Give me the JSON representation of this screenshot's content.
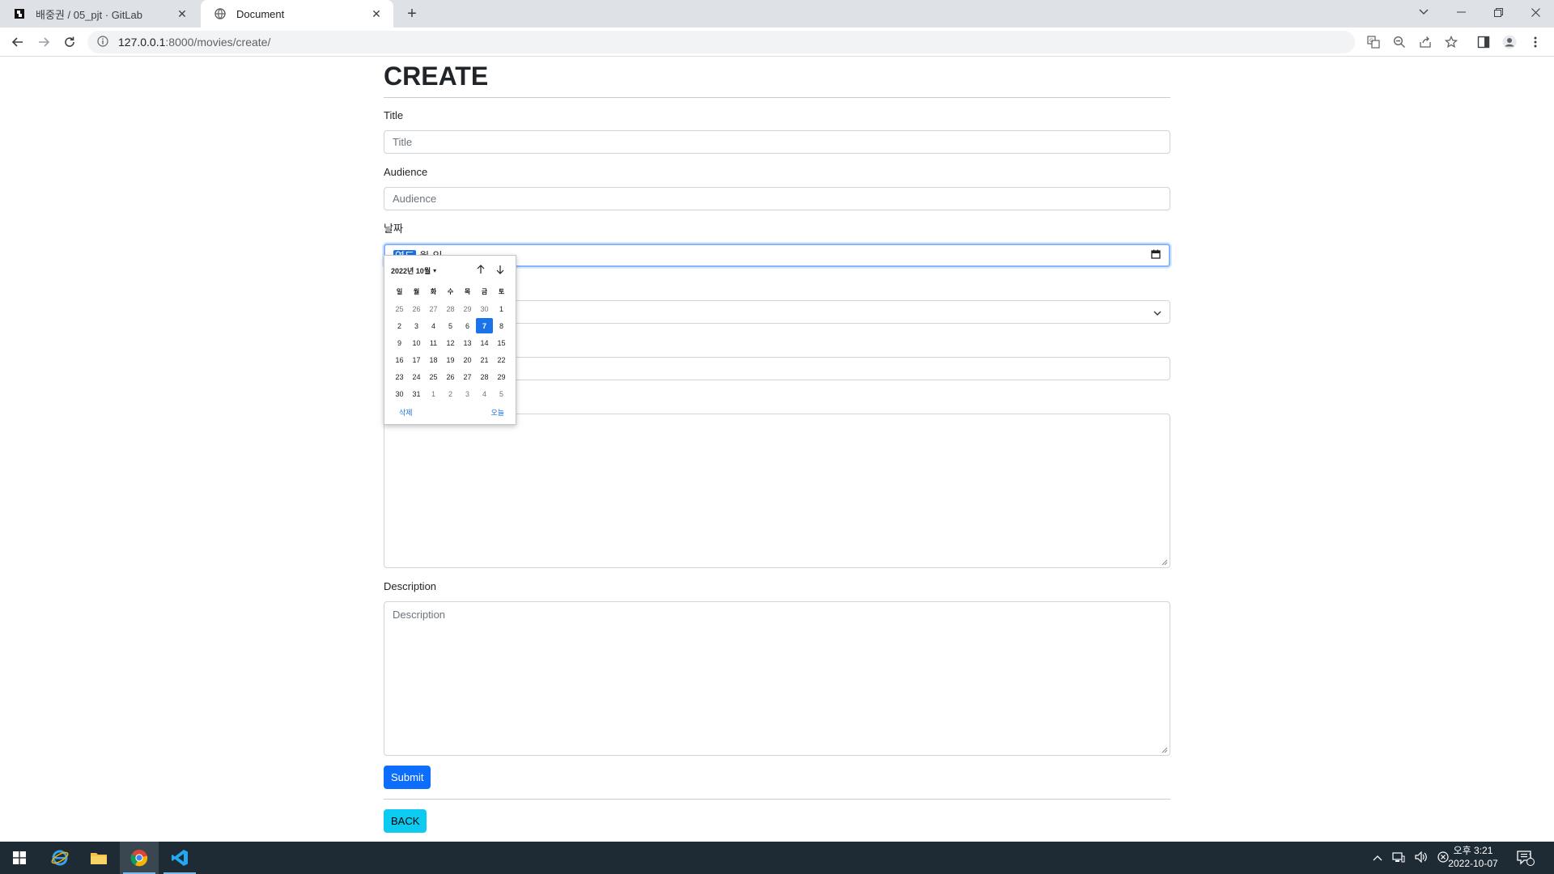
{
  "browser": {
    "tabs": [
      {
        "label": "배중권 / 05_pjt · GitLab",
        "active": false,
        "icon": "gitlab-icon"
      },
      {
        "label": "Document",
        "active": true,
        "icon": "globe-icon"
      }
    ],
    "url_host": "127.0.0.1",
    "url_path": ":8000/movies/create/"
  },
  "page": {
    "title": "CREATE",
    "fields": {
      "title": {
        "label": "Title",
        "placeholder": "Title"
      },
      "audience": {
        "label": "Audience",
        "placeholder": "Audience"
      },
      "date": {
        "label": "날짜",
        "seg_year": "연도",
        "sep1": "-",
        "seg_month": "월",
        "sep2": "-",
        "seg_day": "일"
      },
      "description": {
        "label": "Description",
        "placeholder": "Description"
      }
    },
    "submit_label": "Submit",
    "back_label": "BACK"
  },
  "datepicker": {
    "header": "2022년 10월",
    "weekdays": [
      "일",
      "월",
      "화",
      "수",
      "목",
      "금",
      "토"
    ],
    "weeks": [
      [
        "25",
        "26",
        "27",
        "28",
        "29",
        "30",
        "1"
      ],
      [
        "2",
        "3",
        "4",
        "5",
        "6",
        "7",
        "8"
      ],
      [
        "9",
        "10",
        "11",
        "12",
        "13",
        "14",
        "15"
      ],
      [
        "16",
        "17",
        "18",
        "19",
        "20",
        "21",
        "22"
      ],
      [
        "23",
        "24",
        "25",
        "26",
        "27",
        "28",
        "29"
      ],
      [
        "30",
        "31",
        "1",
        "2",
        "3",
        "4",
        "5"
      ]
    ],
    "selected": "7",
    "clear_label": "삭제",
    "today_label": "오늘"
  },
  "taskbar": {
    "time": "오후 3:21",
    "date": "2022-10-07",
    "notification_count": "1"
  },
  "colors": {
    "primary": "#0d6efd",
    "info": "#0dcaf0",
    "picker_accent": "#1a73e8",
    "taskbar": "#1f2b34"
  }
}
